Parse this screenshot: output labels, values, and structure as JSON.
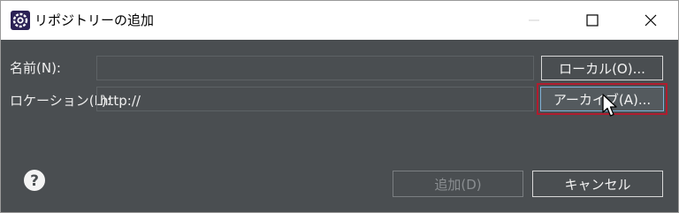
{
  "window": {
    "title": "リポジトリーの追加",
    "icons": {
      "app": "eclipse-gear-icon",
      "minimize": "minimize-icon",
      "maximize": "maximize-icon",
      "close": "close-icon"
    }
  },
  "form": {
    "name_label": "名前(N):",
    "name_value": "",
    "location_label": "ロケーション(L):",
    "location_value": "http://"
  },
  "buttons": {
    "local": "ローカル(O)...",
    "archive": "アーカイブ(A)...",
    "add": "追加(D)",
    "cancel": "キャンセル"
  },
  "footer": {
    "help_icon": "help-question-icon"
  },
  "colors": {
    "background": "#4a4e51",
    "focus_highlight": "#b01c2e",
    "text": "#eeeeee"
  }
}
